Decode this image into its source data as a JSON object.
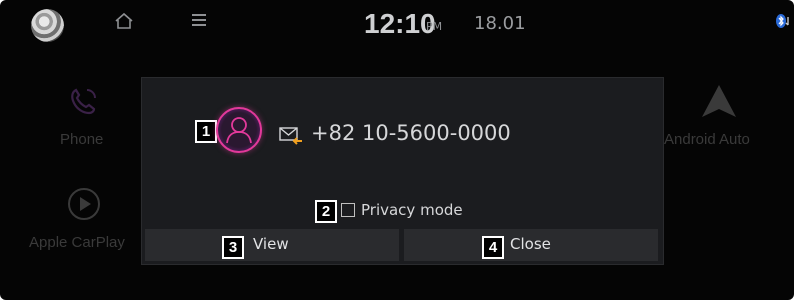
{
  "status_bar": {
    "time": "12:10",
    "ampm": "PM",
    "date": "18.01",
    "icons": [
      "brand-logo-icon",
      "home-icon",
      "menu-icon",
      "bluetooth-icon"
    ]
  },
  "home_screen": {
    "items": [
      {
        "label": "Phone",
        "icon": "phone-icon"
      },
      {
        "label": "Apple CarPlay",
        "icon": "play-icon"
      },
      {
        "label": "Android Auto",
        "icon": "android-auto-icon"
      }
    ]
  },
  "popup": {
    "caller_number": "+82 10-5600-0000",
    "privacy_label": "Privacy mode",
    "privacy_checked": false,
    "view_label": "View",
    "close_label": "Close",
    "callouts": [
      "1",
      "2",
      "3",
      "4"
    ]
  },
  "colors": {
    "background": "#050505",
    "popup_bg": "#1b1c1f",
    "button_bg": "#2a2b2e",
    "avatar_accent": "#e2399a",
    "envelope_arrow": "#f0a020"
  }
}
